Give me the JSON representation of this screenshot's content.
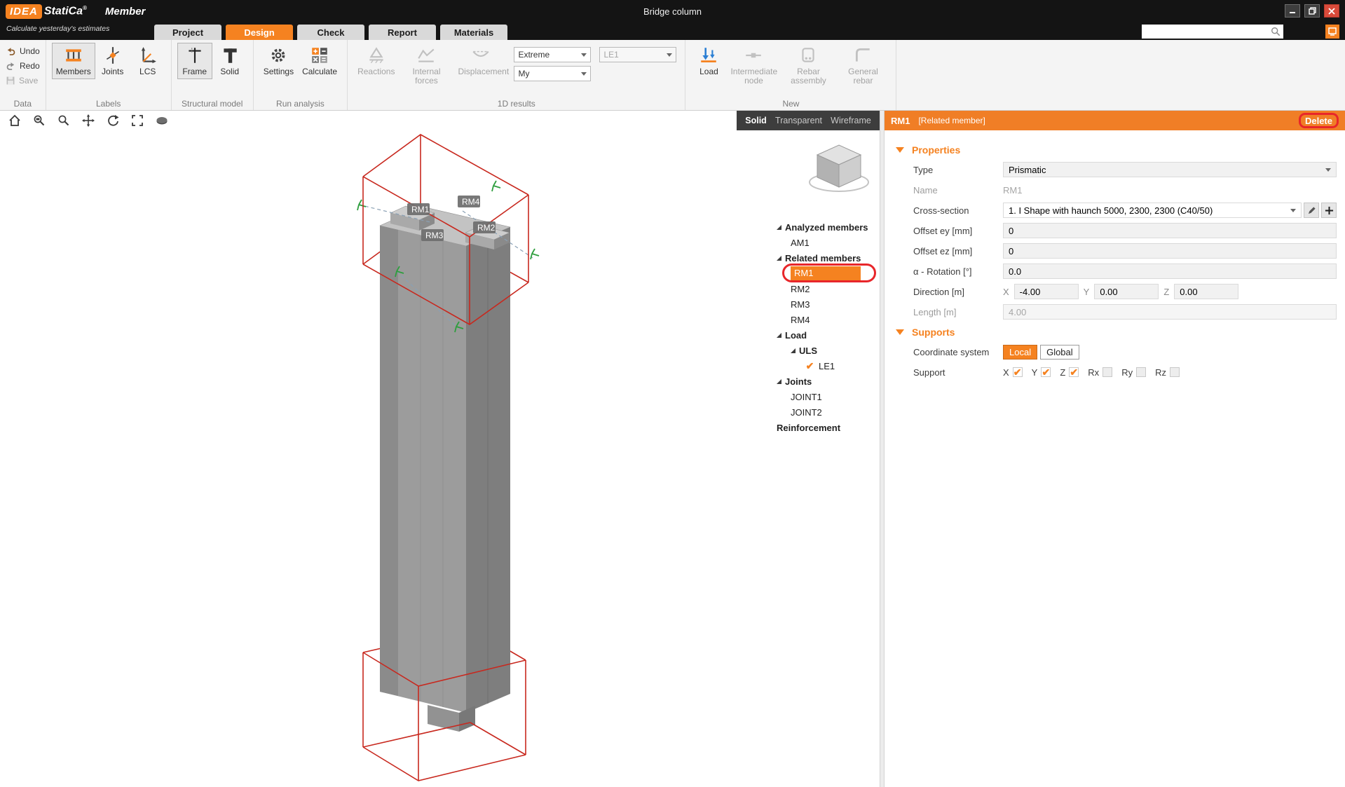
{
  "titlebar": {
    "logo_idea": "IDEA",
    "logo_statica": "StatiCa",
    "logo_reg": "®",
    "app_name": "Member",
    "tagline": "Calculate yesterday's estimates",
    "window_title": "Bridge column"
  },
  "tabs": {
    "items": [
      {
        "label": "Project",
        "active": false
      },
      {
        "label": "Design",
        "active": true
      },
      {
        "label": "Check",
        "active": false
      },
      {
        "label": "Report",
        "active": false
      },
      {
        "label": "Materials",
        "active": false
      }
    ]
  },
  "ribbon": {
    "data": {
      "label": "Data",
      "undo": "Undo",
      "redo": "Redo",
      "save": "Save"
    },
    "labels": {
      "label": "Labels",
      "members": "Members",
      "joints": "Joints",
      "lcs": "LCS"
    },
    "structural": {
      "label": "Structural model",
      "frame": "Frame",
      "solid": "Solid"
    },
    "run": {
      "label": "Run analysis",
      "settings": "Settings",
      "calculate": "Calculate"
    },
    "results": {
      "label": "1D results",
      "reactions": "Reactions",
      "internal_forces": "Internal forces",
      "displacement": "Displacement",
      "extreme": "Extreme",
      "loadcase": "LE1",
      "component": "My"
    },
    "new": {
      "label": "New",
      "load": "Load",
      "intermediate_node": "Intermediate node",
      "rebar_assembly": "Rebar assembly",
      "general_rebar": "General rebar"
    }
  },
  "viewport": {
    "modes": {
      "solid": "Solid",
      "transparent": "Transparent",
      "wireframe": "Wireframe",
      "active": "Solid"
    },
    "scene_labels": {
      "rm1": "RM1",
      "rm2": "RM2",
      "rm3": "RM3",
      "rm4": "RM4"
    }
  },
  "tree": {
    "items": [
      {
        "label": "Analyzed members",
        "level": 0,
        "group": true,
        "expander": true
      },
      {
        "label": "AM1",
        "level": 1
      },
      {
        "label": "Related members",
        "level": 0,
        "group": true,
        "expander": true
      },
      {
        "label": "RM1",
        "level": 1,
        "selected": true,
        "annotated": true
      },
      {
        "label": "RM2",
        "level": 1
      },
      {
        "label": "RM3",
        "level": 1
      },
      {
        "label": "RM4",
        "level": 1
      },
      {
        "label": "Load",
        "level": 0,
        "group": true,
        "expander": true
      },
      {
        "label": "ULS",
        "level": 1,
        "group": true,
        "expander": true
      },
      {
        "label": "LE1",
        "level": 2,
        "checked": true
      },
      {
        "label": "Joints",
        "level": 0,
        "group": true,
        "expander": true
      },
      {
        "label": "JOINT1",
        "level": 1
      },
      {
        "label": "JOINT2",
        "level": 1
      },
      {
        "label": "Reinforcement",
        "level": 0,
        "group": true
      }
    ]
  },
  "panel": {
    "header": {
      "title": "RM1",
      "subtitle": "[Related member]",
      "delete": "Delete"
    },
    "sections": {
      "properties": "Properties",
      "supports": "Supports"
    },
    "props": {
      "type_label": "Type",
      "type_value": "Prismatic",
      "name_label": "Name",
      "name_value": "RM1",
      "cross_section_label": "Cross-section",
      "cross_section_value": "1. I Shape with haunch 5000, 2300, 2300 (C40/50)",
      "offset_ey_label": "Offset ey [mm]",
      "offset_ey_value": "0",
      "offset_ez_label": "Offset ez [mm]",
      "offset_ez_value": "0",
      "rotation_label": "α - Rotation [°]",
      "rotation_value": "0.0",
      "direction_label": "Direction [m]",
      "direction": {
        "x_label": "X",
        "x": "-4.00",
        "y_label": "Y",
        "y": "0.00",
        "z_label": "Z",
        "z": "0.00"
      },
      "length_label": "Length [m]",
      "length_value": "4.00"
    },
    "supports": {
      "coord_label": "Coordinate system",
      "local": "Local",
      "global": "Global",
      "support_label": "Support",
      "checks": [
        {
          "label": "X",
          "checked": true
        },
        {
          "label": "Y",
          "checked": true
        },
        {
          "label": "Z",
          "checked": true
        },
        {
          "label": "Rx",
          "checked": false
        },
        {
          "label": "Ry",
          "checked": false
        },
        {
          "label": "Rz",
          "checked": false
        }
      ]
    }
  },
  "colors": {
    "accent": "#F58220",
    "panel_header": "#F07E26",
    "annotation": "#E8262A",
    "wireframe_red": "#C8281E",
    "load_blue": "#2B7FD4"
  }
}
